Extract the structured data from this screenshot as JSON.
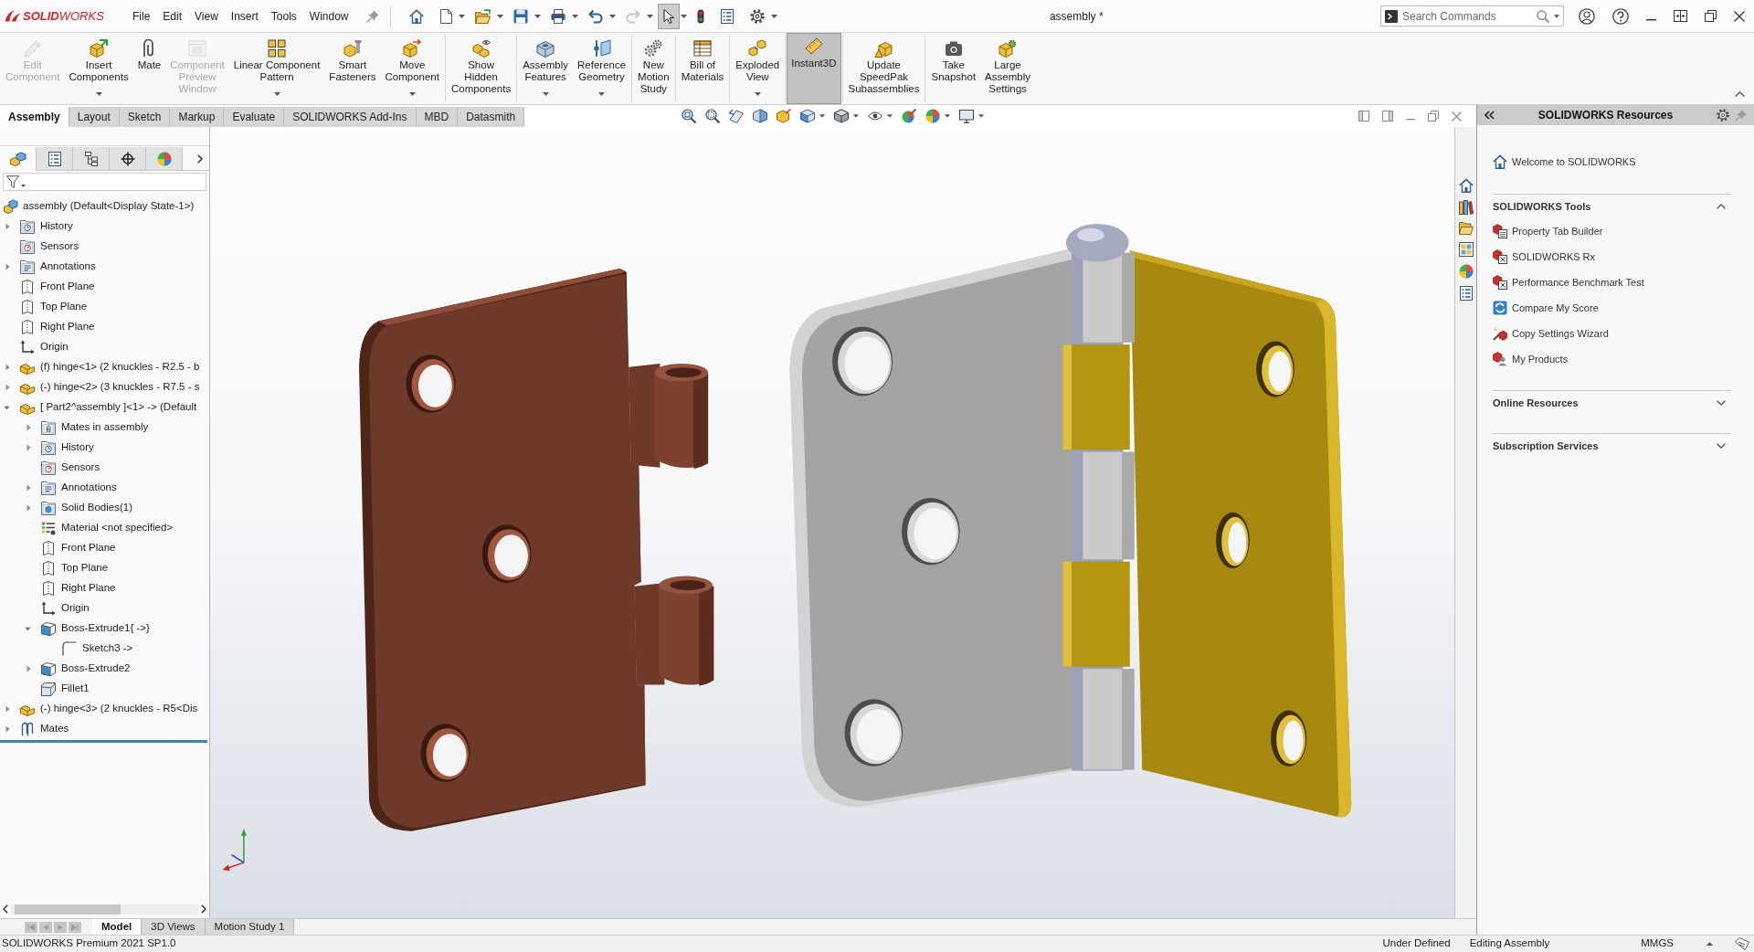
{
  "title_bar": {
    "logo": "**SOLID**WORKS",
    "menu": [
      "File",
      "Edit",
      "View",
      "Insert",
      "Tools",
      "Window"
    ],
    "quick_access": [
      {
        "kind": "home",
        "dropdown": false,
        "disabled": false,
        "on": false
      },
      {
        "kind": "new",
        "dropdown": true,
        "disabled": false,
        "on": false
      },
      {
        "kind": "open",
        "dropdown": true,
        "disabled": false,
        "on": false
      },
      {
        "kind": "save",
        "dropdown": true,
        "disabled": false,
        "on": false
      },
      {
        "kind": "print",
        "dropdown": true,
        "disabled": false,
        "on": false
      },
      {
        "kind": "undo",
        "dropdown": true,
        "disabled": false,
        "on": false
      },
      {
        "kind": "redo",
        "dropdown": true,
        "disabled": true,
        "on": false
      },
      {
        "kind": "select",
        "dropdown": true,
        "disabled": false,
        "on": true
      },
      {
        "kind": "rebuild",
        "dropdown": false,
        "disabled": false,
        "on": false
      },
      {
        "kind": "properties",
        "dropdown": false,
        "disabled": false,
        "on": false
      },
      {
        "kind": "options",
        "dropdown": true,
        "disabled": false,
        "on": false
      }
    ],
    "title": "assembly *",
    "search": {
      "placeholder": "Search Commands"
    }
  },
  "ribbon": {
    "groups": [
      {
        "buttons": [
          {
            "kind": "edit",
            "label": "Edit\nComponent",
            "dropdown": false,
            "disabled": true,
            "on": false
          },
          {
            "kind": "insert",
            "label": "Insert\nComponents",
            "dropdown": true,
            "disabled": false,
            "on": false
          },
          {
            "kind": "mate",
            "label": "Mate",
            "dropdown": false,
            "disabled": false,
            "on": false
          },
          {
            "kind": "preview",
            "label": "Component\nPreview\nWindow",
            "dropdown": false,
            "disabled": true,
            "on": false
          },
          {
            "kind": "pattern",
            "label": "Linear Component\nPattern",
            "dropdown": true,
            "disabled": false,
            "on": false
          },
          {
            "kind": "fasteners",
            "label": "Smart\nFasteners",
            "dropdown": false,
            "disabled": false,
            "on": false
          },
          {
            "kind": "move",
            "label": "Move\nComponent",
            "dropdown": true,
            "disabled": false,
            "on": false
          }
        ]
      },
      {
        "buttons": [
          {
            "kind": "hidden",
            "label": "Show\nHidden\nComponents",
            "dropdown": false,
            "disabled": false,
            "on": false
          }
        ]
      },
      {
        "buttons": [
          {
            "kind": "features",
            "label": "Assembly\nFeatures",
            "dropdown": true,
            "disabled": false,
            "on": false
          },
          {
            "kind": "geometry",
            "label": "Reference\nGeometry",
            "dropdown": true,
            "disabled": false,
            "on": false
          }
        ]
      },
      {
        "buttons": [
          {
            "kind": "motion",
            "label": "New\nMotion\nStudy",
            "dropdown": false,
            "disabled": false,
            "on": false
          }
        ]
      },
      {
        "buttons": [
          {
            "kind": "bom",
            "label": "Bill of\nMaterials",
            "dropdown": false,
            "disabled": false,
            "on": false
          }
        ]
      },
      {
        "buttons": [
          {
            "kind": "explode",
            "label": "Exploded\nView",
            "dropdown": true,
            "disabled": false,
            "on": false
          }
        ]
      },
      {
        "buttons": [
          {
            "kind": "instant3d",
            "label": "Instant3D",
            "dropdown": false,
            "disabled": false,
            "on": true
          }
        ]
      },
      {
        "buttons": [
          {
            "kind": "speedpak",
            "label": "Update\nSpeedPak\nSubassemblies",
            "dropdown": false,
            "disabled": false,
            "on": false
          }
        ]
      },
      {
        "buttons": [
          {
            "kind": "snapshot",
            "label": "Take\nSnapshot",
            "dropdown": false,
            "disabled": false,
            "on": false
          },
          {
            "kind": "large",
            "label": "Large\nAssembly\nSettings",
            "dropdown": false,
            "disabled": false,
            "on": false
          }
        ]
      }
    ]
  },
  "command_tabs": [
    {
      "label": "Assembly",
      "selected": true
    },
    {
      "label": "Layout",
      "selected": false
    },
    {
      "label": "Sketch",
      "selected": false
    },
    {
      "label": "Markup",
      "selected": false
    },
    {
      "label": "Evaluate",
      "selected": false
    },
    {
      "label": "SOLIDWORKS Add-Ins",
      "selected": false
    },
    {
      "label": "MBD",
      "selected": false
    },
    {
      "label": "Datasmith",
      "selected": false
    }
  ],
  "feature_tree": {
    "tabs": [
      {
        "kind": "features",
        "selected": true
      },
      {
        "kind": "properties",
        "selected": false
      },
      {
        "kind": "configurations",
        "selected": false
      },
      {
        "kind": "dimxpert",
        "selected": false
      },
      {
        "kind": "display",
        "selected": false
      }
    ],
    "root": {
      "label": "assembly (Default<Display State-1>)"
    },
    "items": [
      {
        "kind": "history",
        "label": "History",
        "expanded": false
      },
      {
        "kind": "sensors",
        "label": "Sensors"
      },
      {
        "kind": "annotations",
        "label": "Annotations",
        "expanded": false
      },
      {
        "kind": "plane",
        "label": "Front Plane"
      },
      {
        "kind": "plane",
        "label": "Top Plane"
      },
      {
        "kind": "plane",
        "label": "Right Plane"
      },
      {
        "kind": "origin",
        "label": "Origin"
      },
      {
        "kind": "component",
        "label": "(f) hinge<1> (2 knuckles - R2.5 - b",
        "expanded": false
      },
      {
        "kind": "component",
        "label": "(-) hinge<2> (3 knuckles - R7.5 - s",
        "expanded": false
      },
      {
        "kind": "component",
        "label": "[ Part2^assembly ]<1> -> (Default",
        "expanded": true,
        "children": [
          {
            "kind": "matefolder",
            "label": "Mates in assembly",
            "expanded": false
          },
          {
            "kind": "history",
            "label": "History",
            "expanded": false
          },
          {
            "kind": "sensors",
            "label": "Sensors"
          },
          {
            "kind": "annotations",
            "label": "Annotations",
            "expanded": false
          },
          {
            "kind": "bodies",
            "label": "Solid Bodies(1)",
            "expanded": false
          },
          {
            "kind": "material",
            "label": "Material <not specified>"
          },
          {
            "kind": "plane",
            "label": "Front Plane"
          },
          {
            "kind": "plane",
            "label": "Top Plane"
          },
          {
            "kind": "plane",
            "label": "Right Plane"
          },
          {
            "kind": "origin",
            "label": "Origin"
          },
          {
            "kind": "extrude",
            "label": "Boss-Extrude1{ ->}",
            "expanded": true,
            "children": [
              {
                "kind": "sketch",
                "label": "Sketch3 ->"
              }
            ]
          },
          {
            "kind": "extrude",
            "label": "Boss-Extrude2",
            "expanded": false
          },
          {
            "kind": "fillet",
            "label": "Fillet1"
          }
        ]
      },
      {
        "kind": "component",
        "label": "(-) hinge<3> (2 knuckles - R5<Dis",
        "expanded": false
      },
      {
        "kind": "mates",
        "label": "Mates",
        "expanded": false
      }
    ]
  },
  "task_pane": {
    "title": "SOLIDWORKS Resources",
    "welcome": "Welcome to SOLIDWORKS",
    "sections": [
      {
        "title": "SOLIDWORKS Tools",
        "expanded": true,
        "items": [
          {
            "kind": "builder",
            "label": "Property Tab Builder"
          },
          {
            "kind": "rx",
            "label": "SOLIDWORKS Rx"
          },
          {
            "kind": "rx",
            "label": "Performance Benchmark Test"
          },
          {
            "kind": "compare",
            "label": "Compare My Score"
          },
          {
            "kind": "wizard",
            "label": "Copy Settings Wizard"
          },
          {
            "kind": "products",
            "label": "My Products"
          }
        ]
      },
      {
        "title": "Online Resources",
        "expanded": false
      },
      {
        "title": "Subscription Services",
        "expanded": false
      }
    ]
  },
  "bottom_tabs": [
    {
      "label": "Model",
      "selected": true
    },
    {
      "label": "3D Views",
      "selected": false
    },
    {
      "label": "Motion Study 1",
      "selected": false
    }
  ],
  "status_bar": {
    "product": "SOLIDWORKS Premium 2021 SP1.0",
    "state": "Under Defined",
    "mode": "Editing Assembly",
    "units": "MMGS"
  }
}
